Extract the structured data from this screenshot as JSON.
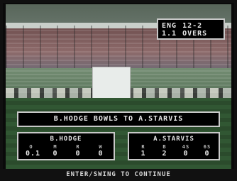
{
  "overs_panel": {
    "team": "ENG",
    "score": "12-2",
    "overs": "1.1",
    "overs_label": "OVERS"
  },
  "banner": {
    "text": "B.HODGE BOWLS TO A.STARVIS"
  },
  "bowler": {
    "name": "B.HODGE",
    "stats": [
      {
        "label": "O",
        "value": "0.1"
      },
      {
        "label": "M",
        "value": "0"
      },
      {
        "label": "R",
        "value": "0"
      },
      {
        "label": "W",
        "value": "0"
      }
    ]
  },
  "batsman": {
    "name": "A.STARVIS",
    "stats": [
      {
        "label": "R",
        "value": "1"
      },
      {
        "label": "B",
        "value": "2"
      },
      {
        "label": "4S",
        "value": "0"
      },
      {
        "label": "6S",
        "value": "0"
      }
    ]
  },
  "prompt": {
    "text": "ENTER/SWING TO CONTINUE"
  }
}
